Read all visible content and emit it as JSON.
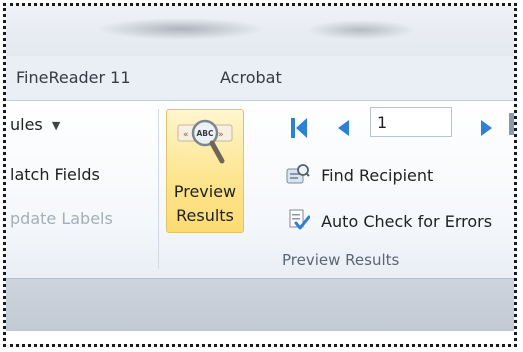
{
  "tabs": [
    "FineReader 11",
    "Acrobat"
  ],
  "write_insert_group": {
    "rules_label": "ules",
    "match_fields_label": "latch Fields",
    "update_labels_label": "pdate Labels"
  },
  "preview_results_group": {
    "preview_button_line1": "Preview",
    "preview_button_line2": "Results",
    "preview_icon_text": "ABC",
    "record_number": "1",
    "find_recipient_label": "Find Recipient",
    "auto_check_label": "Auto Check for Errors",
    "group_label": "Preview Results"
  },
  "colors": {
    "selected_button_fill": "#fde590",
    "nav_arrow_blue": "#2f7fd6"
  }
}
